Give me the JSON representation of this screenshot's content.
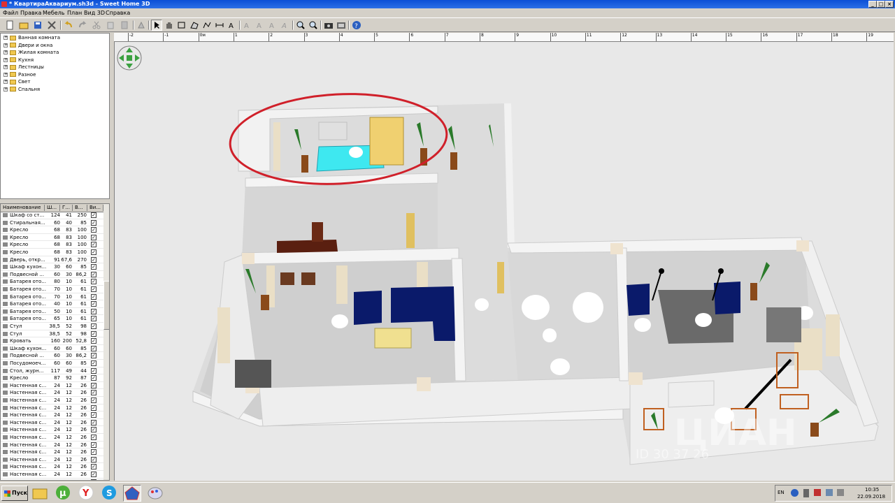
{
  "window": {
    "title": "* КвартираАквариум.sh3d - Sweet Home 3D"
  },
  "menu": [
    "Файл",
    "Правка",
    "Мебель",
    "План",
    "Вид 3D",
    "Справка"
  ],
  "catalog": [
    "Ванная комната",
    "Двери и окна",
    "Жилая комната",
    "Кухня",
    "Лестницы",
    "Разное",
    "Свет",
    "Спальня"
  ],
  "furniture_table": {
    "headers": [
      "Наименование",
      "Ш...",
      "Г...",
      "В...",
      "Ви..."
    ],
    "rows": [
      [
        "Шкаф со ст...",
        "124",
        "41",
        "250"
      ],
      [
        "Стиральная...",
        "60",
        "40",
        "85"
      ],
      [
        "Кресло",
        "68",
        "83",
        "100"
      ],
      [
        "Кресло",
        "68",
        "83",
        "100"
      ],
      [
        "Кресло",
        "68",
        "83",
        "100"
      ],
      [
        "Кресло",
        "68",
        "83",
        "100"
      ],
      [
        "Дверь, откр...",
        "91",
        "67,6",
        "270"
      ],
      [
        "Шкаф кухон...",
        "30",
        "60",
        "85"
      ],
      [
        "Подвесной ...",
        "60",
        "30",
        "86,2"
      ],
      [
        "Батарея ото...",
        "80",
        "10",
        "61"
      ],
      [
        "Батарея ото...",
        "70",
        "10",
        "61"
      ],
      [
        "Батарея ото...",
        "70",
        "10",
        "61"
      ],
      [
        "Батарея ото...",
        "40",
        "10",
        "61"
      ],
      [
        "Батарея ото...",
        "50",
        "10",
        "61"
      ],
      [
        "Батарея ото...",
        "65",
        "10",
        "61"
      ],
      [
        "Стул",
        "38,5",
        "52",
        "98"
      ],
      [
        "Стул",
        "38,5",
        "52",
        "98"
      ],
      [
        "Кровать",
        "160",
        "200",
        "52,8"
      ],
      [
        "Шкаф кухон...",
        "60",
        "60",
        "85"
      ],
      [
        "Подвесной ...",
        "60",
        "30",
        "86,2"
      ],
      [
        "Посудомоеч...",
        "60",
        "60",
        "85"
      ],
      [
        "Стол, журн...",
        "117",
        "49",
        "44"
      ],
      [
        "Кресло",
        "87",
        "92",
        "87"
      ],
      [
        "Настенная с...",
        "24",
        "12",
        "26"
      ],
      [
        "Настенная с...",
        "24",
        "12",
        "26"
      ],
      [
        "Настенная с...",
        "24",
        "12",
        "26"
      ],
      [
        "Настенная с...",
        "24",
        "12",
        "26"
      ],
      [
        "Настенная с...",
        "24",
        "12",
        "26"
      ],
      [
        "Настенная с...",
        "24",
        "12",
        "26"
      ],
      [
        "Настенная с...",
        "24",
        "12",
        "26"
      ],
      [
        "Настенная с...",
        "24",
        "12",
        "26"
      ],
      [
        "Настенная с...",
        "24",
        "12",
        "26"
      ],
      [
        "Настенная с...",
        "24",
        "12",
        "26"
      ],
      [
        "Настенная с...",
        "24",
        "12",
        "26"
      ],
      [
        "Настенная с...",
        "24",
        "12",
        "26"
      ],
      [
        "Настенная с...",
        "24",
        "12",
        "26"
      ],
      [
        "Настенная с...",
        "24",
        "12",
        "26"
      ]
    ]
  },
  "ruler": [
    "-2",
    "-1",
    "0м",
    "1",
    "2",
    "3",
    "4",
    "5",
    "6",
    "7",
    "8",
    "9",
    "10",
    "11",
    "12",
    "13",
    "14",
    "15",
    "16",
    "17",
    "18",
    "19"
  ],
  "taskbar": {
    "start": "Пуск",
    "lang": "EN",
    "time": "10:35",
    "date": "22.09.2018"
  },
  "watermark": "ЦИАН",
  "watermark_id": "ID 30 37 26"
}
